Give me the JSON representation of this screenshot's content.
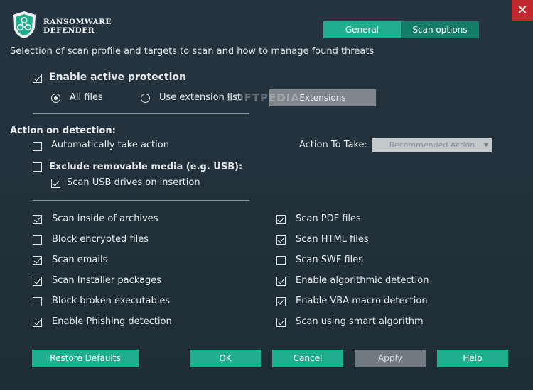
{
  "app": {
    "brand_line1": "Ransomware",
    "brand_line2": "Defender",
    "close_glyph": "✕",
    "watermark": "SOFTPEDIA"
  },
  "tabs": [
    {
      "label": "General",
      "active": false
    },
    {
      "label": "Scan options",
      "active": true
    }
  ],
  "description": "Selection of scan profile and targets to scan and how to manage found threats",
  "protection": {
    "enable_label": "Enable active protection",
    "enable_checked": true,
    "all_files_label": "All files",
    "all_files_selected": true,
    "extension_list_label": "Use extension list",
    "extension_list_selected": false,
    "extensions_button": "Extensions"
  },
  "action": {
    "heading": "Action on detection:",
    "auto_label": "Automatically  take action",
    "auto_checked": false,
    "action_to_take_label": "Action To Take:",
    "action_select_value": "Recommended Action",
    "exclude_label": "Exclude removable media (e.g. USB):",
    "exclude_checked": false,
    "scan_usb_label": "Scan USB drives on insertion",
    "scan_usb_checked": true
  },
  "options_left": [
    {
      "label": "Scan inside of archives",
      "checked": true
    },
    {
      "label": "Block encrypted files",
      "checked": false
    },
    {
      "label": "Scan emails",
      "checked": true
    },
    {
      "label": "Scan Installer packages",
      "checked": true
    },
    {
      "label": "Block broken executables",
      "checked": false
    },
    {
      "label": "Enable Phishing detection",
      "checked": true
    }
  ],
  "options_right": [
    {
      "label": "Scan PDF files",
      "checked": true
    },
    {
      "label": "Scan HTML files",
      "checked": true
    },
    {
      "label": "Scan SWF files",
      "checked": false
    },
    {
      "label": "Enable algorithmic detection",
      "checked": true
    },
    {
      "label": "Enable VBA macro detection",
      "checked": true
    },
    {
      "label": "Scan using smart algorithm",
      "checked": true
    }
  ],
  "footer": {
    "restore": "Restore Defaults",
    "ok": "OK",
    "cancel": "Cancel",
    "apply": "Apply",
    "help": "Help"
  },
  "colors": {
    "accent": "#1fae8e",
    "accent_dark": "#147d67",
    "background": "#22303a",
    "close": "#c0282e"
  }
}
